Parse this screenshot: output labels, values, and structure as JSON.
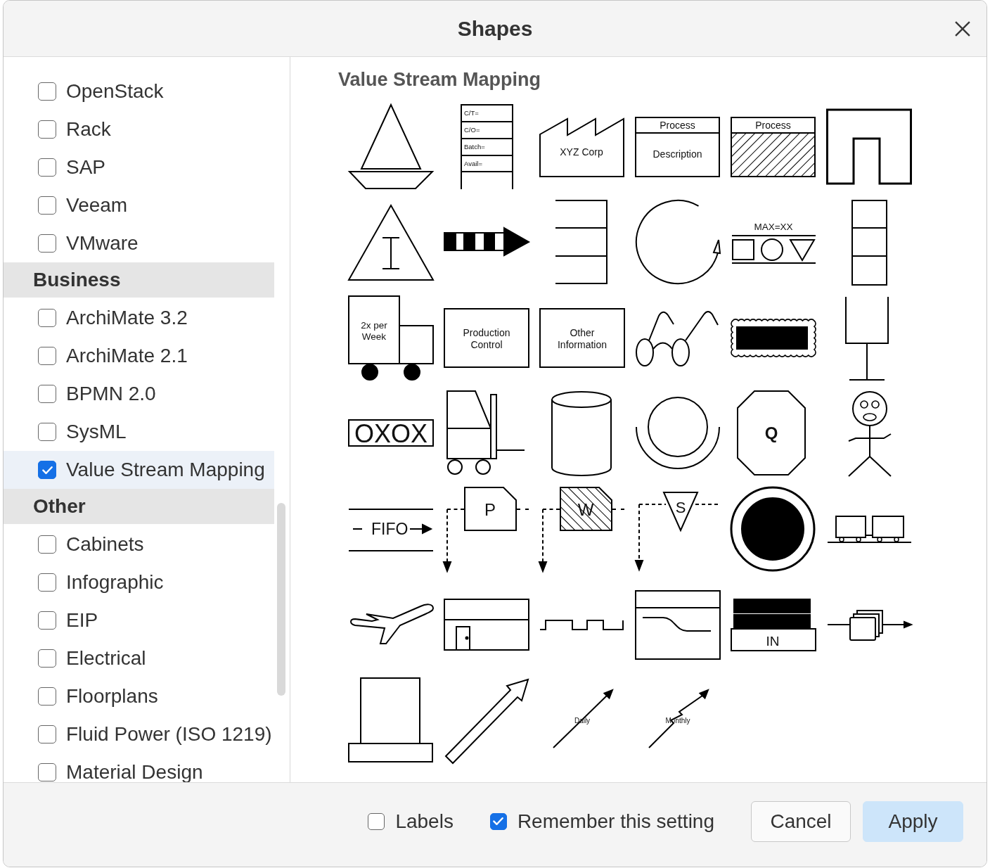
{
  "dialog": {
    "title": "Shapes"
  },
  "sidebar": {
    "items": [
      {
        "kind": "option",
        "label": "OpenStack",
        "checked": false,
        "selected": false
      },
      {
        "kind": "option",
        "label": "Rack",
        "checked": false,
        "selected": false
      },
      {
        "kind": "option",
        "label": "SAP",
        "checked": false,
        "selected": false
      },
      {
        "kind": "option",
        "label": "Veeam",
        "checked": false,
        "selected": false
      },
      {
        "kind": "option",
        "label": "VMware",
        "checked": false,
        "selected": false
      },
      {
        "kind": "header",
        "label": "Business"
      },
      {
        "kind": "option",
        "label": "ArchiMate 3.2",
        "checked": false,
        "selected": false
      },
      {
        "kind": "option",
        "label": "ArchiMate 2.1",
        "checked": false,
        "selected": false
      },
      {
        "kind": "option",
        "label": "BPMN 2.0",
        "checked": false,
        "selected": false
      },
      {
        "kind": "option",
        "label": "SysML",
        "checked": false,
        "selected": false
      },
      {
        "kind": "option",
        "label": "Value Stream Mapping",
        "checked": true,
        "selected": true
      },
      {
        "kind": "header",
        "label": "Other"
      },
      {
        "kind": "option",
        "label": "Cabinets",
        "checked": false,
        "selected": false
      },
      {
        "kind": "option",
        "label": "Infographic",
        "checked": false,
        "selected": false
      },
      {
        "kind": "option",
        "label": "EIP",
        "checked": false,
        "selected": false
      },
      {
        "kind": "option",
        "label": "Electrical",
        "checked": false,
        "selected": false
      },
      {
        "kind": "option",
        "label": "Floorplans",
        "checked": false,
        "selected": false
      },
      {
        "kind": "option",
        "label": "Fluid Power (ISO 1219)",
        "checked": false,
        "selected": false
      },
      {
        "kind": "option",
        "label": "Material Design",
        "checked": false,
        "selected": false
      }
    ]
  },
  "panel": {
    "title": "Value Stream Mapping",
    "shapes": [
      {
        "kind": "boat"
      },
      {
        "kind": "databox",
        "lines": [
          "C/T=",
          "C/O=",
          "Batch=",
          "Avail="
        ]
      },
      {
        "kind": "factory",
        "label": "XYZ Corp"
      },
      {
        "kind": "process",
        "header": "Process",
        "label": "Description",
        "hatched": false
      },
      {
        "kind": "process",
        "header": "Process",
        "hatched": true
      },
      {
        "kind": "cell"
      },
      {
        "kind": "inventory"
      },
      {
        "kind": "pusharrow"
      },
      {
        "kind": "supermarket"
      },
      {
        "kind": "pull"
      },
      {
        "kind": "fifolimit",
        "label": "MAX=XX"
      },
      {
        "kind": "buffer"
      },
      {
        "kind": "truck",
        "lines": [
          "2x per",
          "Week"
        ]
      },
      {
        "kind": "infobox",
        "lines": [
          "Production",
          "Control"
        ]
      },
      {
        "kind": "infobox",
        "lines": [
          "Other",
          "Information"
        ]
      },
      {
        "kind": "gosee"
      },
      {
        "kind": "wavybox"
      },
      {
        "kind": "kanbanpost"
      },
      {
        "kind": "leveling",
        "label": "OXOX"
      },
      {
        "kind": "forklift"
      },
      {
        "kind": "cylinder"
      },
      {
        "kind": "pullball"
      },
      {
        "kind": "quality",
        "label": "Q"
      },
      {
        "kind": "operator"
      },
      {
        "kind": "fifo",
        "label": "FIFO"
      },
      {
        "kind": "kanban",
        "label": "P",
        "hatched": false
      },
      {
        "kind": "kanban",
        "label": "W",
        "hatched": true
      },
      {
        "kind": "signal",
        "label": "S"
      },
      {
        "kind": "target"
      },
      {
        "kind": "rail"
      },
      {
        "kind": "airplane"
      },
      {
        "kind": "warehouse"
      },
      {
        "kind": "timeline"
      },
      {
        "kind": "curvepanel"
      },
      {
        "kind": "batch",
        "label": "IN"
      },
      {
        "kind": "cards"
      },
      {
        "kind": "pedestal"
      },
      {
        "kind": "hollowarrow"
      },
      {
        "kind": "infoarrow",
        "label": "Daily",
        "zigzag": false
      },
      {
        "kind": "infoarrow",
        "label": "Monthly",
        "zigzag": true
      }
    ]
  },
  "footer": {
    "options": [
      {
        "label": "Labels",
        "checked": false
      },
      {
        "label": "Remember this setting",
        "checked": true
      }
    ],
    "buttons": [
      {
        "label": "Cancel",
        "kind": "cancel"
      },
      {
        "label": "Apply",
        "kind": "apply"
      }
    ]
  }
}
